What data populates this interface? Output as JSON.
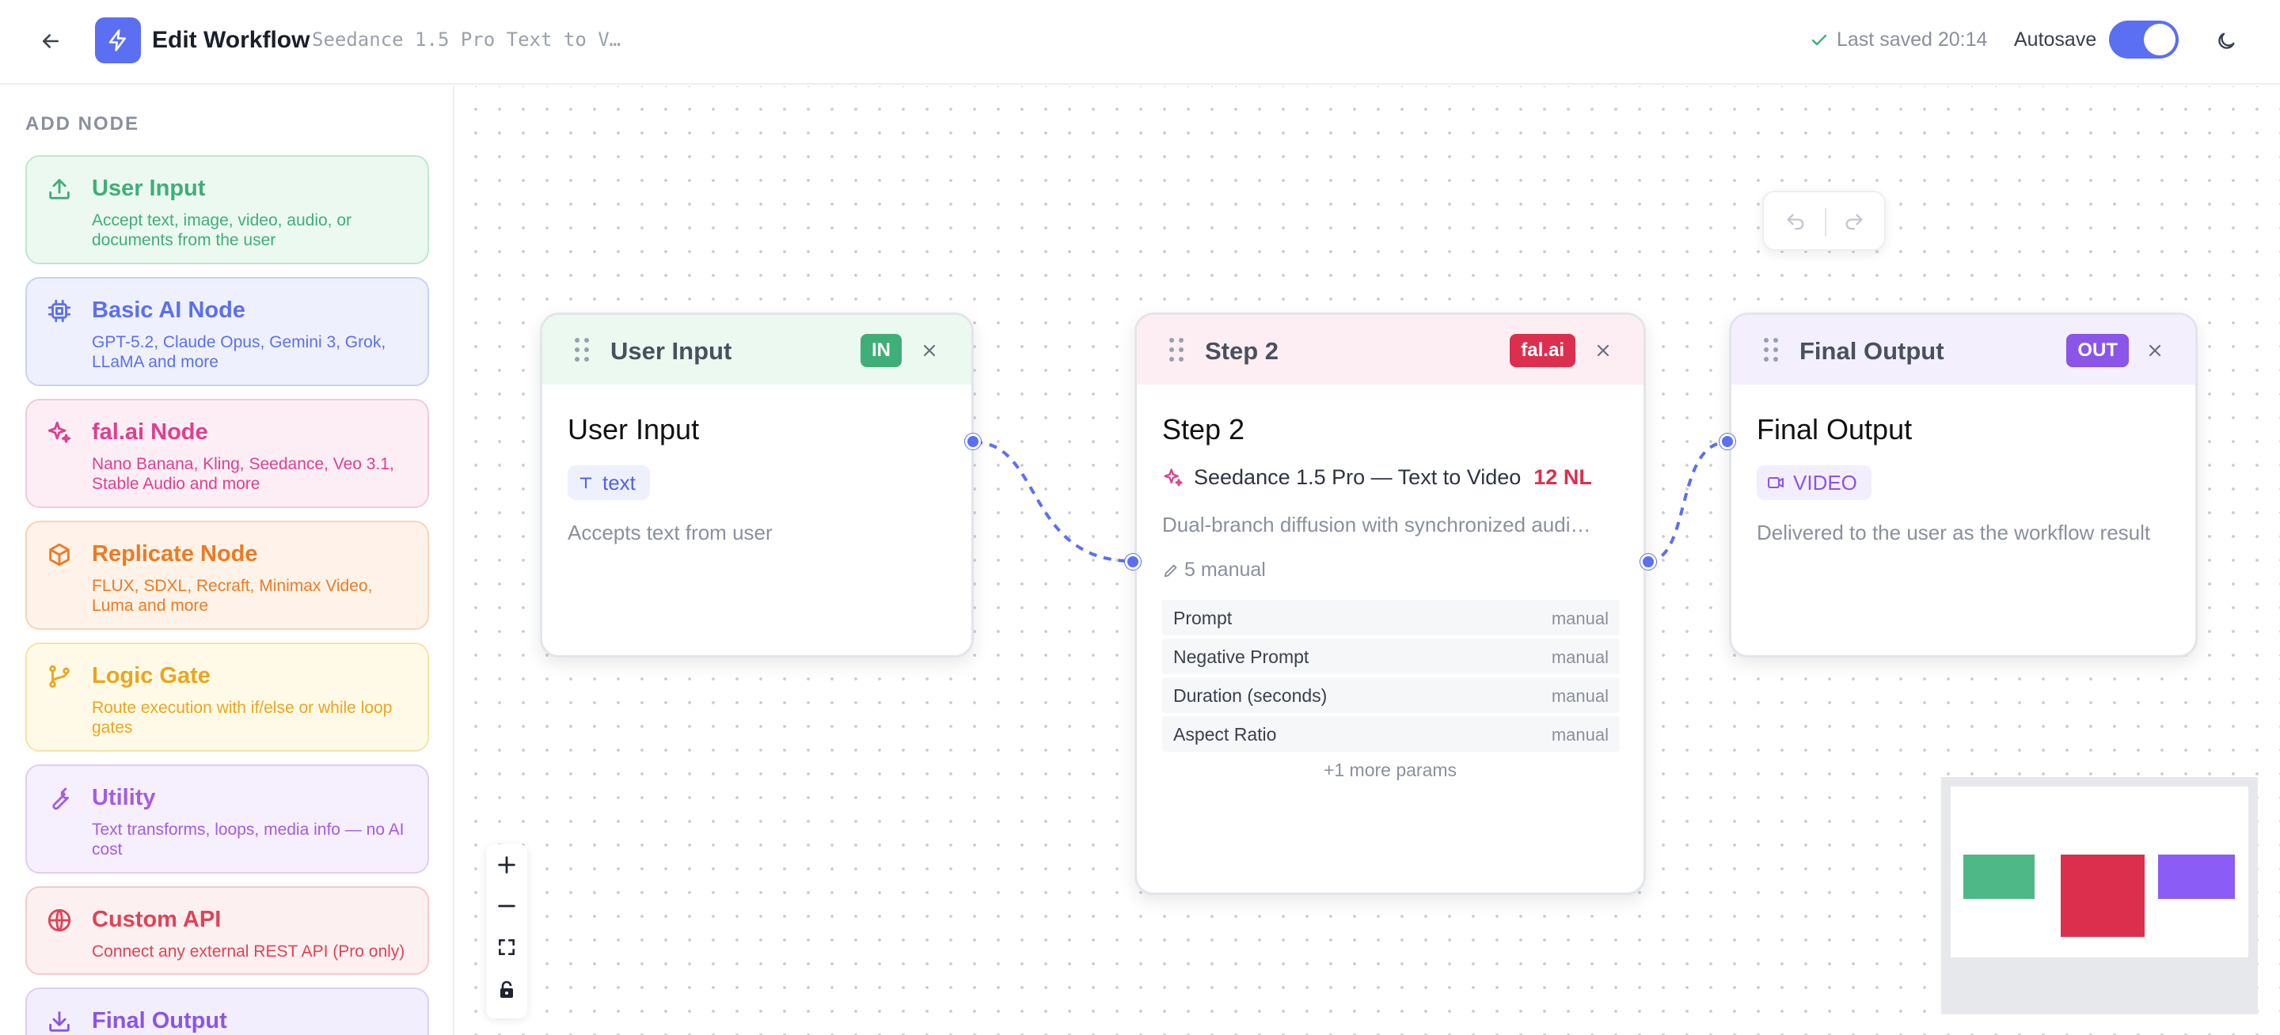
{
  "header": {
    "title": "Edit Workflow",
    "subtitle": "Seedance 1.5 Pro Text to V…",
    "saved_text": "Last saved 20:14",
    "autosave_label": "Autosave",
    "autosave_on": true,
    "icons": {
      "back": "arrow-left-icon",
      "logo": "lightning-icon",
      "saved": "check-icon",
      "theme": "moon-icon"
    }
  },
  "sidebar": {
    "heading": "ADD NODE",
    "items": [
      {
        "title": "User Input",
        "desc": "Accept text, image, video, audio, or documents from the user",
        "icon": "upload-icon",
        "color": "#3fae78",
        "bg": "#ebf9f1",
        "border": "#bde8cf"
      },
      {
        "title": "Basic AI Node",
        "desc": "GPT-5.2, Claude Opus, Gemini 3, Grok, LLaMA and more",
        "icon": "chip-icon",
        "color": "#5b6ff2",
        "bg": "#eef1fd",
        "border": "#c7d0f8"
      },
      {
        "title": "fal.ai Node",
        "desc": "Nano Banana, Kling, Seedance, Veo 3.1, Stable Audio and more",
        "icon": "sparkle-icon",
        "color": "#df3f8f",
        "bg": "#fdeef5",
        "border": "#f4c8dc"
      },
      {
        "title": "Replicate Node",
        "desc": "FLUX, SDXL, Recraft, Minimax Video, Luma and more",
        "icon": "cube-icon",
        "color": "#ee7a22",
        "bg": "#fff3e9",
        "border": "#f8d4b5"
      },
      {
        "title": "Logic Gate",
        "desc": "Route execution with if/else or while loop gates",
        "icon": "branch-icon",
        "color": "#eda51c",
        "bg": "#fffae8",
        "border": "#f6e3a6"
      },
      {
        "title": "Utility",
        "desc": "Text transforms, loops, media info — no AI cost",
        "icon": "wrench-icon",
        "color": "#a35ee0",
        "bg": "#f6effd",
        "border": "#e0cdf6"
      },
      {
        "title": "Custom API",
        "desc": "Connect any external REST API (Pro only)",
        "icon": "globe-icon",
        "color": "#e04356",
        "bg": "#fdf0f1",
        "border": "#f5c9cf"
      },
      {
        "title": "Final Output",
        "desc": "",
        "icon": "download-icon",
        "color": "#8a55e8",
        "bg": "#f3eefd",
        "border": "#ddcdf7"
      }
    ]
  },
  "canvas": {
    "nodes": {
      "input": {
        "header_title": "User Input",
        "badge": "IN",
        "badge_color": "#3fae78",
        "title": "User Input",
        "chip_label": "text",
        "chip_icon": "text-type-icon",
        "desc": "Accepts text from user"
      },
      "step": {
        "header_title": "Step 2",
        "badge": "fal.ai",
        "badge_color": "#dc2f4e",
        "title": "Step 2",
        "model": "Seedance 1.5 Pro — Text to Video",
        "model_tag": "12 NL",
        "desc": "Dual-branch diffusion with synchronized audi…",
        "manual_count": "5 manual",
        "params": [
          {
            "name": "Prompt",
            "value": "manual"
          },
          {
            "name": "Negative Prompt",
            "value": "manual"
          },
          {
            "name": "Duration (seconds)",
            "value": "manual"
          },
          {
            "name": "Aspect Ratio",
            "value": "manual"
          }
        ],
        "more_params": "+1 more params"
      },
      "output": {
        "header_title": "Final Output",
        "badge": "OUT",
        "badge_color": "#8a55e8",
        "title": "Final Output",
        "chip_label": "VIDEO",
        "chip_icon": "video-icon",
        "desc": "Delivered to the user as the workflow result"
      }
    },
    "minimap_colors": [
      "#4fb887",
      "#dc2f4e",
      "#8b5cf6"
    ],
    "zoom_controls": [
      "zoom-in-icon",
      "zoom-out-icon",
      "fit-view-icon",
      "lock-icon"
    ]
  }
}
